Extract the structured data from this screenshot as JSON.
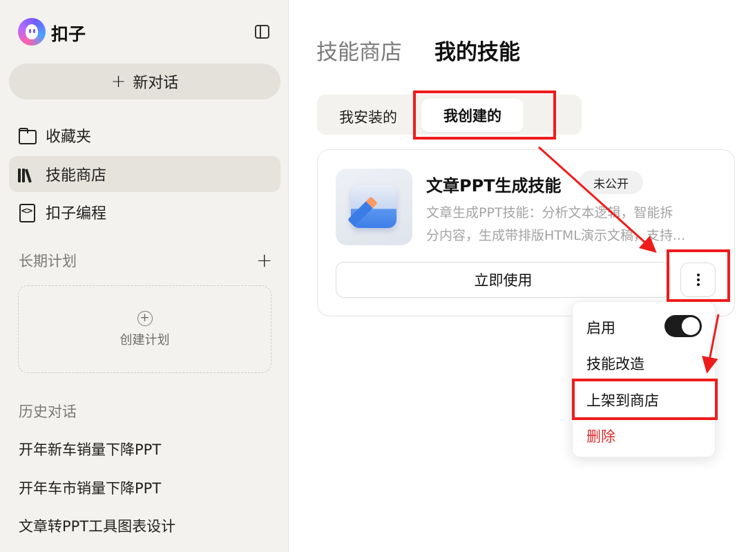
{
  "sidebar": {
    "brand": "扣子",
    "new_chat_label": "新对话",
    "new_chat_plus": "+",
    "nav": [
      {
        "label": "收藏夹",
        "icon": "folder-icon"
      },
      {
        "label": "技能商店",
        "icon": "books-icon",
        "active": true
      },
      {
        "label": "扣子编程",
        "icon": "code-file-icon"
      }
    ],
    "plans_label": "长期计划",
    "plans_add": "+",
    "create_plan_plus": "+",
    "create_plan_label": "创建计划",
    "history_label": "历史对话",
    "history": [
      "开年新车销量下降PPT",
      "开年车市销量下降PPT",
      "文章转PPT工具图表设计"
    ]
  },
  "main": {
    "tabs": [
      "技能商店",
      "我的技能"
    ],
    "active_tab": "我的技能",
    "segments": [
      "我安装的",
      "我创建的"
    ],
    "active_segment": "我创建的",
    "card": {
      "title": "文章PPT生成技能",
      "badge": "未公开",
      "desc_line1": "文章生成PPT技能：分析文本逻辑，智能拆",
      "desc_line2": "分内容，生成带排版HTML演示文稿，支持...",
      "use_label": "立即使用",
      "icon": "pencil-icon"
    },
    "menu": {
      "enable_label": "启用",
      "enabled": true,
      "items": [
        "技能改造",
        "上架到商店"
      ],
      "delete_label": "删除"
    }
  },
  "colors": {
    "annotation_red": "#ef1c1c",
    "delete_red": "#e02d2d",
    "sidebar_bg": "#f3f2ee"
  }
}
